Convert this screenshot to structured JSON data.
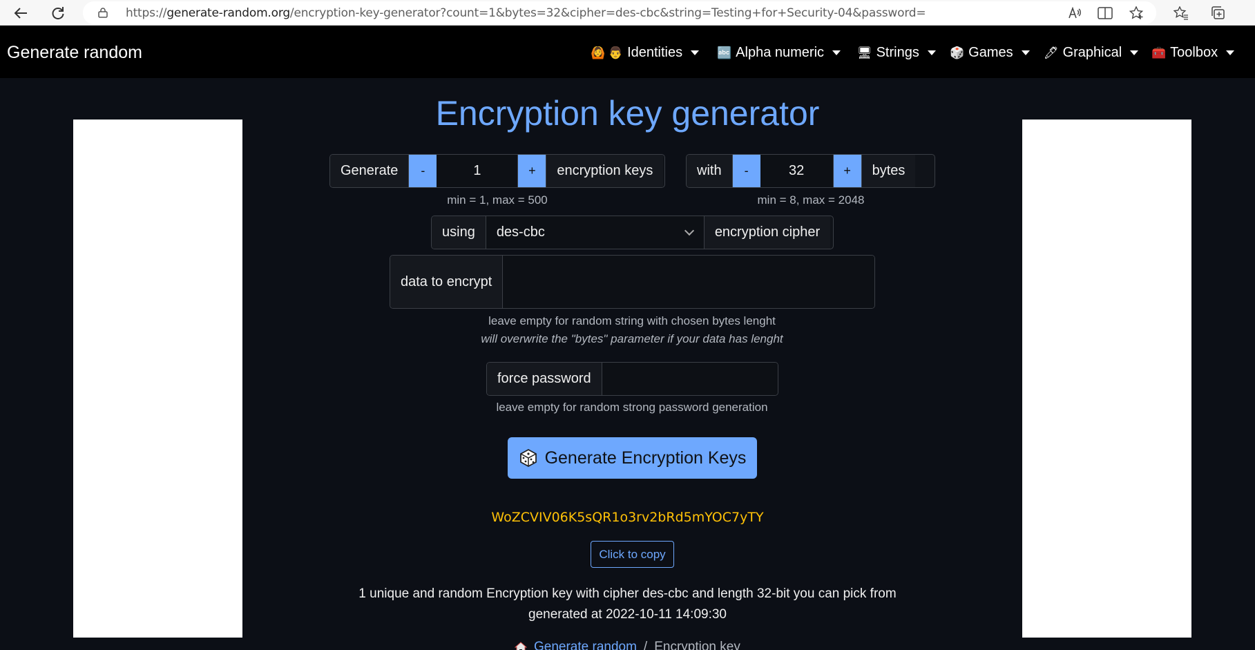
{
  "browser": {
    "url_prefix": "https://",
    "url_host": "generate-random.org",
    "url_path": "/encryption-key-generator?count=1&bytes=32&cipher=des-cbc&string=Testing+for+Security-04&password="
  },
  "navbar": {
    "brand": "Generate random",
    "items": [
      {
        "emoji": "🙆 👨",
        "label": "Identities"
      },
      {
        "emoji": "🔤",
        "label": "Alpha numeric"
      },
      {
        "emoji": "🖥",
        "label": "Strings"
      },
      {
        "emoji": "🎲",
        "label": "Games"
      },
      {
        "emoji": "🖊",
        "label": "Graphical"
      },
      {
        "emoji": "🧰",
        "label": "Toolbox"
      }
    ]
  },
  "main": {
    "title": "Encryption key generator",
    "count_group": {
      "prefix": "Generate",
      "minus": "-",
      "value": "1",
      "plus": "+",
      "suffix": "encryption keys",
      "hint": "min = 1, max = 500"
    },
    "bytes_group": {
      "prefix": "with",
      "minus": "-",
      "value": "32",
      "plus": "+",
      "suffix": "bytes",
      "hint": "min = 8, max = 2048"
    },
    "cipher_group": {
      "prefix": "using",
      "selected": "des-cbc",
      "suffix": "encryption cipher"
    },
    "data_group": {
      "label": "data to encrypt",
      "value": "",
      "hint1": "leave empty for random string with chosen bytes lenght",
      "hint2": "will overwrite the \"bytes\" parameter if your data has lenght"
    },
    "password_group": {
      "label": "force password",
      "value": "",
      "hint": "leave empty for random strong password generation"
    },
    "generate_button": "Generate Encryption Keys",
    "result_key": "WoZCVIV06K5sQR1o3rv2bRd5mYOC7yTY",
    "copy_button": "Click to copy",
    "summary_line1": "1 unique and random Encryption key with cipher des-cbc and length 32-bit you can pick from",
    "summary_line2": "generated at 2022-10-11 14:09:30",
    "breadcrumb": {
      "home": "Generate random",
      "separator": "/",
      "current": "Encryption key"
    }
  },
  "colors": {
    "accent": "#6ea8fe",
    "key": "#ffc107",
    "background": "#0c0f16"
  }
}
